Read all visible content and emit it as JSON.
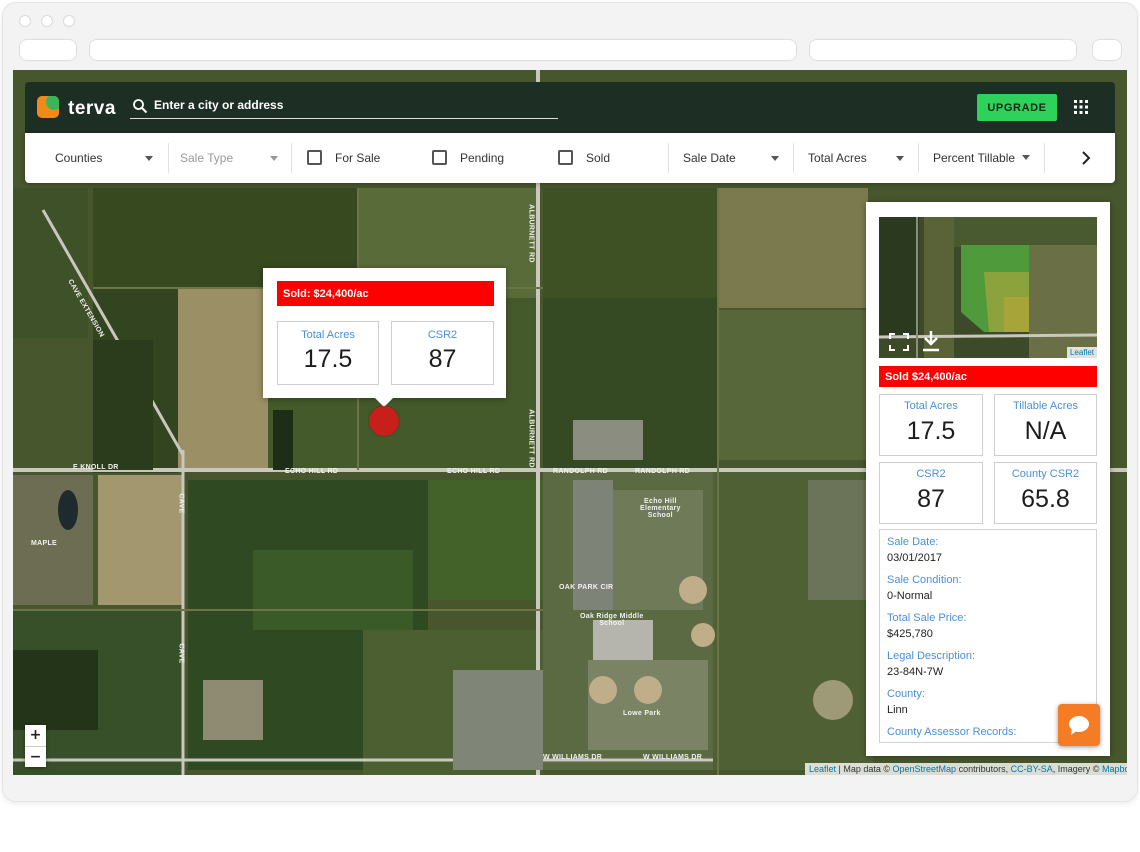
{
  "app": {
    "logo_text": "terva",
    "search_placeholder": "Enter a city or address",
    "upgrade_label": "UPGRADE"
  },
  "filters": {
    "counties": "Counties",
    "sale_type": "Sale Type",
    "for_sale": "For Sale",
    "pending": "Pending",
    "sold": "Sold",
    "sale_date": "Sale Date",
    "total_acres": "Total Acres",
    "percent_tillable": "Percent Tillable"
  },
  "popup": {
    "status": "Sold: $24,400/ac",
    "total_acres_label": "Total Acres",
    "total_acres_value": "17.5",
    "csr2_label": "CSR2",
    "csr2_value": "87"
  },
  "panel": {
    "thumb_leaflet": "Leaflet",
    "status": "Sold $24,400/ac",
    "total_acres_label": "Total Acres",
    "total_acres_value": "17.5",
    "tillable_label": "Tillable Acres",
    "tillable_value": "N/A",
    "csr2_label": "CSR2",
    "csr2_value": "87",
    "county_csr2_label": "County CSR2",
    "county_csr2_value": "65.8",
    "details": {
      "sale_date_label": "Sale Date:",
      "sale_date": "03/01/2017",
      "sale_condition_label": "Sale Condition:",
      "sale_condition": "0-Normal",
      "total_price_label": "Total Sale Price:",
      "total_price": "$425,780",
      "legal_label": "Legal Description:",
      "legal": "23-84N-7W",
      "county_label": "County:",
      "county": "Linn",
      "assessor_label": "County Assessor Records:"
    }
  },
  "map": {
    "zoom_in": "+",
    "zoom_out": "−",
    "attribution": {
      "leaflet": "Leaflet",
      "map_data": " | Map data © ",
      "osm": "OpenStreetMap",
      "contributors": " contributors, ",
      "license": "CC-BY-SA",
      "imagery": ", Imagery © ",
      "mapbox": "Mapbox"
    },
    "labels": {
      "echo_hill_1": "ECHO HILL RD",
      "echo_hill_2": "ECHO HILL RD",
      "randolph_1": "RANDOLPH RD",
      "randolph_2": "RANDOLPH RD",
      "knoll": "E KNOLL DR",
      "school_1": "Echo Hill",
      "school_2": "Elementary",
      "school_3": "School",
      "oak_ridge_1": "Oak Ridge Middle",
      "oak_ridge_2": "School",
      "oak_park": "OAK PARK CIR",
      "lowe_park": "Lowe Park",
      "williams_1": "W WILLIAMS DR",
      "williams_2": "W WILLIAMS DR",
      "maple": "MAPLE",
      "alburnett": "ALBURNETT RD",
      "alburnett_2": "ALBURNETT RD",
      "cave_1": "CAVE",
      "cave_2": "CAVE",
      "cave_ext": "CAVE EXTENSION"
    }
  },
  "colors": {
    "appbar": "#1d2f25",
    "upgrade": "#2ed15a",
    "sold_red": "#ff0000",
    "label_blue": "#4a90d9",
    "chat_orange": "#f57c25",
    "logo_orange": "#f28a1b",
    "logo_green": "#3cb55a"
  },
  "icons": [
    "search-icon",
    "grid-icon",
    "chevron-down-icon",
    "chevron-right-icon",
    "checkbox-icon",
    "expand-icon",
    "download-icon",
    "chat-icon",
    "location-marker"
  ]
}
